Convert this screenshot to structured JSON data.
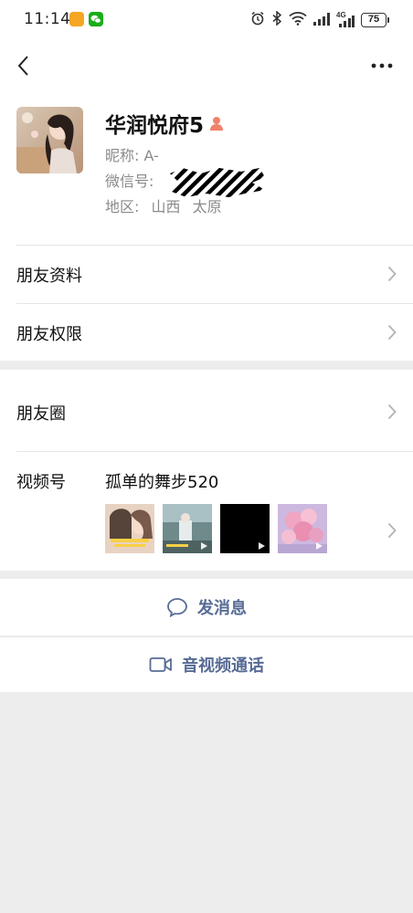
{
  "status_bar": {
    "time": "11:14",
    "network": "4G",
    "battery": "75"
  },
  "nav": {
    "back_icon": "chevron-left-icon",
    "more_icon": "more-dots-icon"
  },
  "profile": {
    "name": "华润悦府5",
    "nickname_label": "昵称:",
    "nickname": "A-",
    "wechat_id_label": "微信号:",
    "region_label": "地区:",
    "province": "山西",
    "city": "太原"
  },
  "menu": {
    "friend_profile": "朋友资料",
    "friend_permissions": "朋友权限",
    "moments": "朋友圈",
    "channels_label": "视频号",
    "channel_name": "孤单的舞步520"
  },
  "actions": {
    "send_message": "发消息",
    "video_call": "音视频通话"
  },
  "colors": {
    "link": "#576b95",
    "page_bg": "#ededed"
  }
}
